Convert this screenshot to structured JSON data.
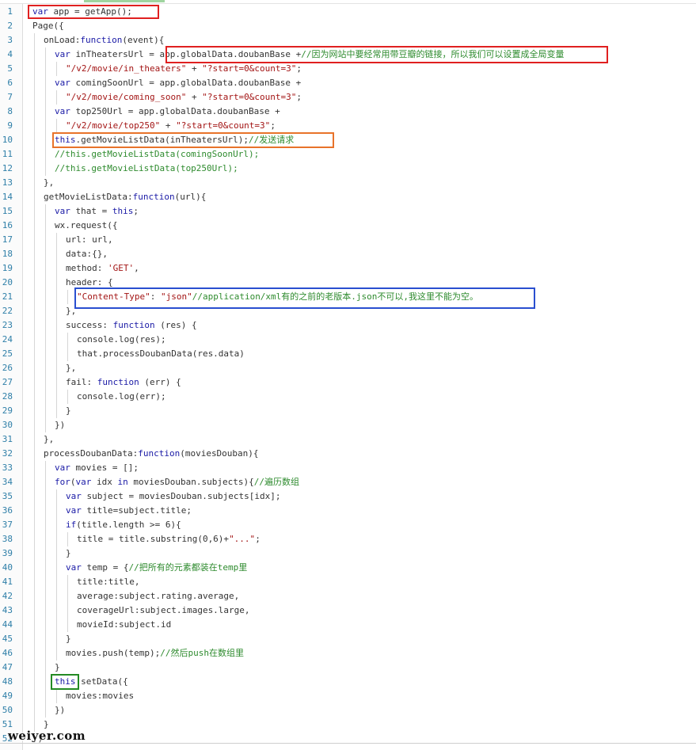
{
  "watermark": "weiyer.com",
  "lines": [
    {
      "n": "1",
      "indent": 0,
      "tokens": [
        {
          "t": "var",
          "c": "kw"
        },
        {
          "t": " app = getApp();"
        }
      ]
    },
    {
      "n": "2",
      "indent": 0,
      "tokens": [
        {
          "t": "Page({"
        }
      ]
    },
    {
      "n": "3",
      "indent": 1,
      "tokens": [
        {
          "t": "onLoad:"
        },
        {
          "t": "function",
          "c": "kw"
        },
        {
          "t": "(event){"
        }
      ]
    },
    {
      "n": "4",
      "indent": 2,
      "tokens": [
        {
          "t": "var",
          "c": "kw"
        },
        {
          "t": " inTheatersUrl = app.globalData.doubanBase +"
        },
        {
          "t": "//因为网站中要经常用带豆瓣的链接，所以我们可以设置成全局变量",
          "c": "cm"
        }
      ]
    },
    {
      "n": "5",
      "indent": 3,
      "tokens": [
        {
          "t": "\"/v2/movie/in_theaters\"",
          "c": "str"
        },
        {
          "t": " + "
        },
        {
          "t": "\"?start=0&count=3\"",
          "c": "str"
        },
        {
          "t": ";"
        }
      ]
    },
    {
      "n": "6",
      "indent": 2,
      "tokens": [
        {
          "t": "var",
          "c": "kw"
        },
        {
          "t": " comingSoonUrl = app.globalData.doubanBase +"
        }
      ]
    },
    {
      "n": "7",
      "indent": 3,
      "tokens": [
        {
          "t": "\"/v2/movie/coming_soon\"",
          "c": "str"
        },
        {
          "t": " + "
        },
        {
          "t": "\"?start=0&count=3\"",
          "c": "str"
        },
        {
          "t": ";"
        }
      ]
    },
    {
      "n": "8",
      "indent": 2,
      "tokens": [
        {
          "t": "var",
          "c": "kw"
        },
        {
          "t": " top250Url = app.globalData.doubanBase +"
        }
      ]
    },
    {
      "n": "9",
      "indent": 3,
      "tokens": [
        {
          "t": "\"/v2/movie/top250\"",
          "c": "str"
        },
        {
          "t": " + "
        },
        {
          "t": "\"?start=0&count=3\"",
          "c": "str"
        },
        {
          "t": ";"
        }
      ]
    },
    {
      "n": "10",
      "indent": 2,
      "tokens": [
        {
          "t": "this",
          "c": "kw"
        },
        {
          "t": ".getMovieListData(inTheatersUrl);"
        },
        {
          "t": "//发送请求",
          "c": "cm"
        }
      ]
    },
    {
      "n": "11",
      "indent": 2,
      "tokens": [
        {
          "t": "//this.getMovieListData(comingSoonUrl);",
          "c": "cm"
        }
      ]
    },
    {
      "n": "12",
      "indent": 2,
      "tokens": [
        {
          "t": "//this.getMovieListData(top250Url);",
          "c": "cm"
        }
      ]
    },
    {
      "n": "13",
      "indent": 1,
      "tokens": [
        {
          "t": "},"
        }
      ]
    },
    {
      "n": "14",
      "indent": 1,
      "tokens": [
        {
          "t": "getMovieListData:"
        },
        {
          "t": "function",
          "c": "kw"
        },
        {
          "t": "(url){"
        }
      ]
    },
    {
      "n": "15",
      "indent": 2,
      "tokens": [
        {
          "t": "var",
          "c": "kw"
        },
        {
          "t": " that = "
        },
        {
          "t": "this",
          "c": "kw"
        },
        {
          "t": ";"
        }
      ]
    },
    {
      "n": "16",
      "indent": 2,
      "tokens": [
        {
          "t": "wx.request({"
        }
      ]
    },
    {
      "n": "17",
      "indent": 3,
      "tokens": [
        {
          "t": "url: url,"
        }
      ]
    },
    {
      "n": "18",
      "indent": 3,
      "tokens": [
        {
          "t": "data:{},"
        }
      ]
    },
    {
      "n": "19",
      "indent": 3,
      "tokens": [
        {
          "t": "method: "
        },
        {
          "t": "'GET'",
          "c": "str"
        },
        {
          "t": ","
        }
      ]
    },
    {
      "n": "20",
      "indent": 3,
      "tokens": [
        {
          "t": "header: {"
        }
      ]
    },
    {
      "n": "21",
      "indent": 4,
      "tokens": [
        {
          "t": "\"Content-Type\"",
          "c": "str"
        },
        {
          "t": ": "
        },
        {
          "t": "\"json\"",
          "c": "str"
        },
        {
          "t": "//application/xml有的之前的老版本.json不可以,我这里不能为空。",
          "c": "cm"
        }
      ]
    },
    {
      "n": "22",
      "indent": 3,
      "tokens": [
        {
          "t": "},"
        }
      ]
    },
    {
      "n": "23",
      "indent": 3,
      "tokens": [
        {
          "t": "success: "
        },
        {
          "t": "function",
          "c": "kw"
        },
        {
          "t": " (res) {"
        }
      ]
    },
    {
      "n": "24",
      "indent": 4,
      "tokens": [
        {
          "t": "console.log(res);"
        }
      ]
    },
    {
      "n": "25",
      "indent": 4,
      "tokens": [
        {
          "t": "that.processDoubanData(res.data)"
        }
      ]
    },
    {
      "n": "26",
      "indent": 3,
      "tokens": [
        {
          "t": "},"
        }
      ]
    },
    {
      "n": "27",
      "indent": 3,
      "tokens": [
        {
          "t": "fail: "
        },
        {
          "t": "function",
          "c": "kw"
        },
        {
          "t": " (err) {"
        }
      ]
    },
    {
      "n": "28",
      "indent": 4,
      "tokens": [
        {
          "t": "console.log(err);"
        }
      ]
    },
    {
      "n": "29",
      "indent": 3,
      "tokens": [
        {
          "t": "}"
        }
      ]
    },
    {
      "n": "30",
      "indent": 2,
      "tokens": [
        {
          "t": "})"
        }
      ]
    },
    {
      "n": "31",
      "indent": 1,
      "tokens": [
        {
          "t": "},"
        }
      ]
    },
    {
      "n": "32",
      "indent": 1,
      "tokens": [
        {
          "t": "processDoubanData:"
        },
        {
          "t": "function",
          "c": "kw"
        },
        {
          "t": "(moviesDouban){"
        }
      ]
    },
    {
      "n": "33",
      "indent": 2,
      "tokens": [
        {
          "t": "var",
          "c": "kw"
        },
        {
          "t": " movies = [];"
        }
      ]
    },
    {
      "n": "34",
      "indent": 2,
      "tokens": [
        {
          "t": "for",
          "c": "kw"
        },
        {
          "t": "("
        },
        {
          "t": "var",
          "c": "kw"
        },
        {
          "t": " idx "
        },
        {
          "t": "in",
          "c": "kw"
        },
        {
          "t": " moviesDouban.subjects){"
        },
        {
          "t": "//遍历数组",
          "c": "cm"
        }
      ]
    },
    {
      "n": "35",
      "indent": 3,
      "tokens": [
        {
          "t": "var",
          "c": "kw"
        },
        {
          "t": " subject = moviesDouban.subjects[idx];"
        }
      ]
    },
    {
      "n": "36",
      "indent": 3,
      "tokens": [
        {
          "t": "var",
          "c": "kw"
        },
        {
          "t": " title=subject.title;"
        }
      ]
    },
    {
      "n": "37",
      "indent": 3,
      "tokens": [
        {
          "t": "if",
          "c": "kw"
        },
        {
          "t": "(title.length >= 6){"
        }
      ]
    },
    {
      "n": "38",
      "indent": 4,
      "tokens": [
        {
          "t": "title = title.substring(0,6)+"
        },
        {
          "t": "\"...\"",
          "c": "str"
        },
        {
          "t": ";"
        }
      ]
    },
    {
      "n": "39",
      "indent": 3,
      "tokens": [
        {
          "t": "}"
        }
      ]
    },
    {
      "n": "40",
      "indent": 3,
      "tokens": [
        {
          "t": "var",
          "c": "kw"
        },
        {
          "t": " temp = {"
        },
        {
          "t": "//把所有的元素都装在temp里",
          "c": "cm"
        }
      ]
    },
    {
      "n": "41",
      "indent": 4,
      "tokens": [
        {
          "t": "title:title,"
        }
      ]
    },
    {
      "n": "42",
      "indent": 4,
      "tokens": [
        {
          "t": "average:subject.rating.average,"
        }
      ]
    },
    {
      "n": "43",
      "indent": 4,
      "tokens": [
        {
          "t": "coverageUrl:subject.images.large,"
        }
      ]
    },
    {
      "n": "44",
      "indent": 4,
      "tokens": [
        {
          "t": "movieId:subject.id"
        }
      ]
    },
    {
      "n": "45",
      "indent": 3,
      "tokens": [
        {
          "t": "}"
        }
      ]
    },
    {
      "n": "46",
      "indent": 3,
      "tokens": [
        {
          "t": "movies.push(temp);"
        },
        {
          "t": "//然后push在数组里",
          "c": "cm"
        }
      ]
    },
    {
      "n": "47",
      "indent": 2,
      "tokens": [
        {
          "t": "}"
        }
      ]
    },
    {
      "n": "48",
      "indent": 2,
      "tokens": [
        {
          "t": "this",
          "c": "kw"
        },
        {
          "t": ".setData({"
        }
      ]
    },
    {
      "n": "49",
      "indent": 3,
      "tokens": [
        {
          "t": "movies:movies"
        }
      ]
    },
    {
      "n": "50",
      "indent": 2,
      "tokens": [
        {
          "t": "})"
        }
      ]
    },
    {
      "n": "51",
      "indent": 1,
      "tokens": [
        {
          "t": "}"
        }
      ]
    },
    {
      "n": "52",
      "indent": 0,
      "tokens": [
        {
          "t": "})"
        }
      ]
    }
  ]
}
